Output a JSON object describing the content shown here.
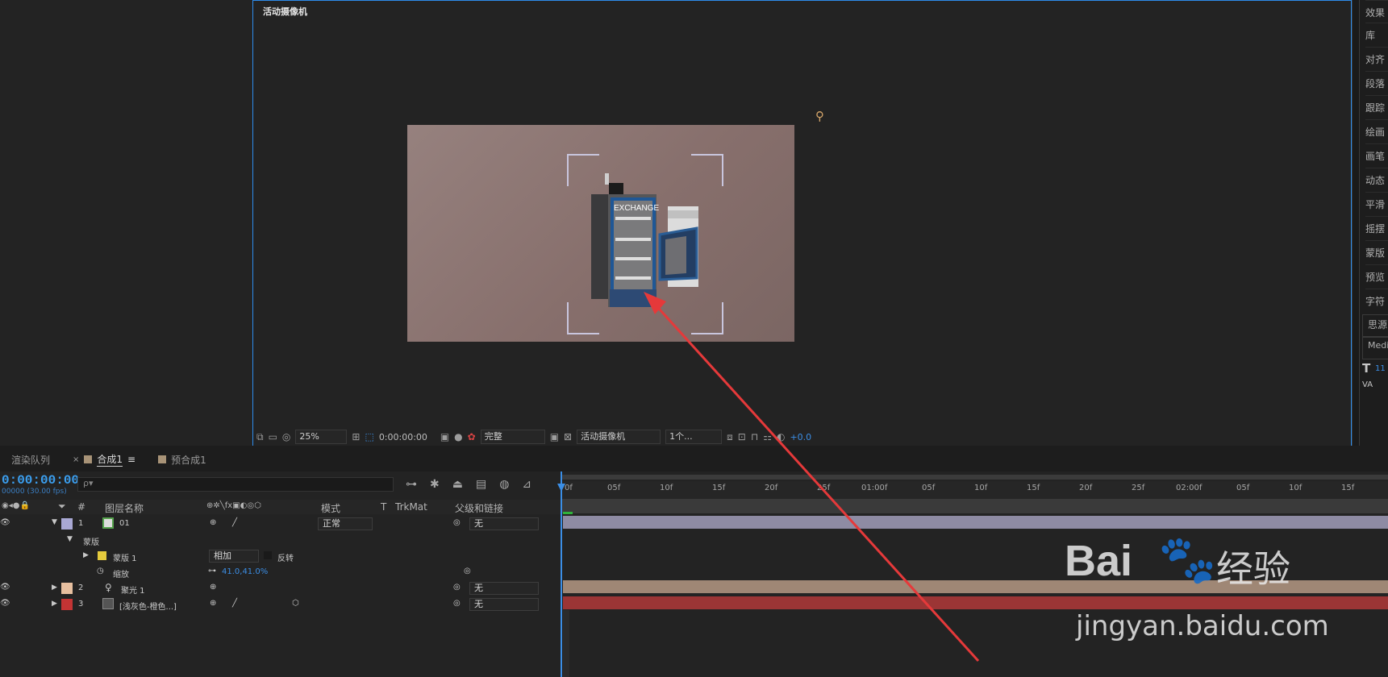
{
  "viewer": {
    "title": "活动摄像机",
    "zoom": "25%",
    "time": "0:00:00:00",
    "quality": "完整",
    "camera": "活动摄像机",
    "views": "1个...",
    "exposure": "+0.0"
  },
  "stage": {
    "product_label": "EXCHANGE"
  },
  "right_panel": {
    "items": [
      "效果",
      "库",
      "对齐",
      "段落",
      "跟踪",
      "绘画",
      "画笔",
      "动态",
      "平滑",
      "摇摆",
      "蒙版",
      "预览",
      "字符"
    ],
    "font": "思源",
    "weight": "Medi",
    "size": "11"
  },
  "tabs": {
    "render_queue": "渲染队列",
    "comp": "合成1",
    "precomp": "预合成1"
  },
  "timeline": {
    "timecode": "0:00:00:00",
    "fps": "00000 (30.00 fps)",
    "search_placeholder": "ρ▾",
    "headers": {
      "num": "#",
      "name": "图层名称",
      "mode": "模式",
      "t": "T",
      "trkmat": "TrkMat",
      "parent": "父级和链接"
    },
    "layers": [
      {
        "index": "1",
        "name": "01",
        "mode": "正常",
        "parent": "无",
        "color": "#a9a8d4"
      },
      {
        "index": "2",
        "name": "聚光 1",
        "parent": "无",
        "color": "#e7bf9f"
      },
      {
        "index": "3",
        "name": "[浅灰色-橙色...]",
        "parent": "无",
        "color": "#c33434"
      }
    ],
    "mask_group": "蒙版",
    "mask": {
      "name": "蒙版 1",
      "mode": "相加",
      "invert": "反转"
    },
    "scale": {
      "label": "缩放",
      "value": "41.0,41.0%"
    },
    "ruler": [
      "0f",
      "05f",
      "10f",
      "15f",
      "20f",
      "25f",
      "01:00f",
      "05f",
      "10f",
      "15f",
      "20f",
      "25f",
      "02:00f",
      "05f",
      "10f",
      "15f"
    ]
  },
  "watermark": {
    "brand": "Bai",
    "brand2": "经验",
    "url": "jingyan.baidu.com"
  }
}
